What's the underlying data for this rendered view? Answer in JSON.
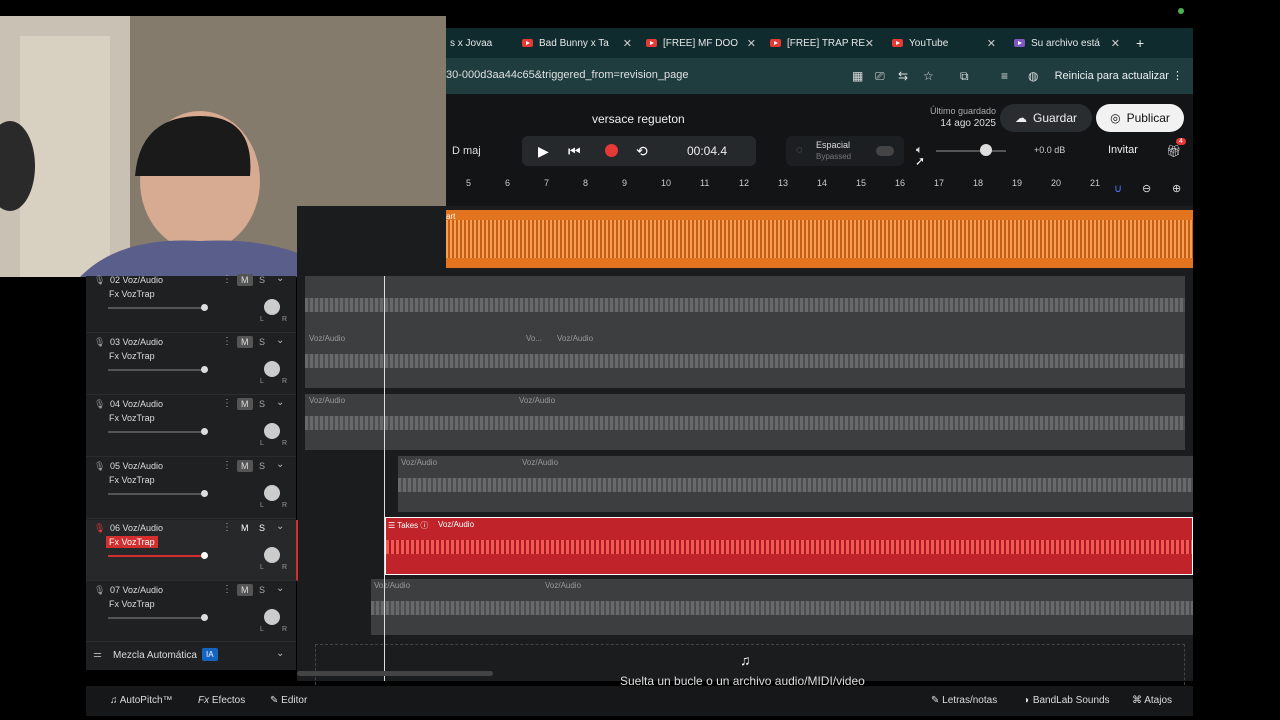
{
  "browser": {
    "tabs": [
      {
        "label": "s x Jovaa"
      },
      {
        "label": "Bad Bunny x Ta"
      },
      {
        "label": "[FREE] MF DOO"
      },
      {
        "label": "[FREE] TRAP RE"
      },
      {
        "label": "YouTube"
      },
      {
        "label": "Su archivo está"
      }
    ],
    "new_tab": "+",
    "url": "30-000d3aa44c65&triggered_from=revision_page",
    "update_button": "Reinicia para actualizar"
  },
  "header": {
    "song_title": "versace regueton",
    "last_saved_label": "Último guardado",
    "last_saved_date": "14 ago 2025",
    "save_label": "Guardar",
    "publish_label": "Publicar"
  },
  "transport": {
    "key": "D maj",
    "time": "00:04.4",
    "spatial_label": "Espacial",
    "spatial_status": "Bypassed",
    "volume_db": "+0.0 dB",
    "invite_label": "Invitar",
    "notification_count": "4"
  },
  "ruler": [
    "5",
    "6",
    "7",
    "8",
    "9",
    "10",
    "11",
    "12",
    "13",
    "14",
    "15",
    "16",
    "17",
    "18",
    "19",
    "20",
    "21"
  ],
  "tracks": [
    {
      "num": "02",
      "name": "Voz/Audio",
      "fx": "Fx VozTrap",
      "mute": "M",
      "solo": "S",
      "pan_l": "L",
      "pan_r": "R"
    },
    {
      "num": "03",
      "name": "Voz/Audio",
      "fx": "Fx VozTrap",
      "mute": "M",
      "solo": "S",
      "pan_l": "L",
      "pan_r": "R"
    },
    {
      "num": "04",
      "name": "Voz/Audio",
      "fx": "Fx VozTrap",
      "mute": "M",
      "solo": "S",
      "pan_l": "L",
      "pan_r": "R"
    },
    {
      "num": "05",
      "name": "Voz/Audio",
      "fx": "Fx VozTrap",
      "mute": "M",
      "solo": "S",
      "pan_l": "L",
      "pan_r": "R"
    },
    {
      "num": "06",
      "name": "Voz/Audio",
      "fx": "Fx VozTrap",
      "mute": "M",
      "solo": "S",
      "pan_l": "L",
      "pan_r": "R"
    },
    {
      "num": "07",
      "name": "Voz/Audio",
      "fx": "Fx VozTrap",
      "mute": "M",
      "solo": "S",
      "pan_l": "L",
      "pan_r": "R"
    }
  ],
  "clips": {
    "beat_label": "art",
    "clip_label": "Voz/Audio",
    "short_clip_label": "Vo...",
    "takes_label": "Takes"
  },
  "auto_mix": {
    "label": "Mezcla Automática",
    "badge": "IA"
  },
  "drop_zone": "Suelta un bucle o un archivo audio/MIDI/video",
  "bottom": {
    "autopitch": "AutoPitch™",
    "effects": "Efectos",
    "editor": "Editor",
    "lyrics": "Letras/notas",
    "sounds": "BandLab Sounds",
    "shortcuts": "Atajos"
  }
}
